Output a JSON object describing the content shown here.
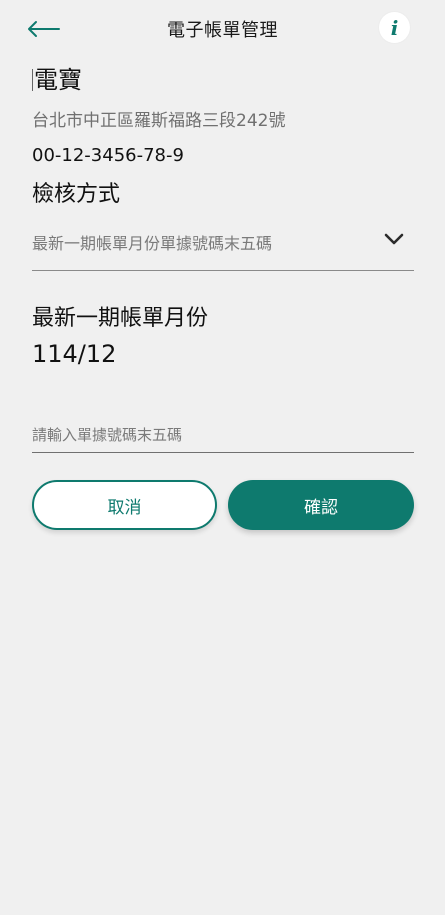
{
  "header": {
    "title": "電子帳單管理",
    "back_icon": "arrow-left-icon",
    "info_label": "i",
    "info_icon": "info-icon"
  },
  "account": {
    "name": "電寶",
    "address": "台北市中正區羅斯福路三段242號",
    "number": "00-12-3456-78-9"
  },
  "verification": {
    "label": "檢核方式",
    "selected_option": "最新一期帳單月份單據號碼末五碼",
    "dropdown_icon": "chevron-down-icon"
  },
  "latest_bill": {
    "label": "最新一期帳單月份",
    "value": "114/12"
  },
  "receipt_input": {
    "placeholder": "請輸入單據號碼末五碼",
    "value": ""
  },
  "actions": {
    "cancel_label": "取消",
    "confirm_label": "確認"
  },
  "colors": {
    "accent": "#0e7a6e",
    "background": "#f0f0f0"
  }
}
